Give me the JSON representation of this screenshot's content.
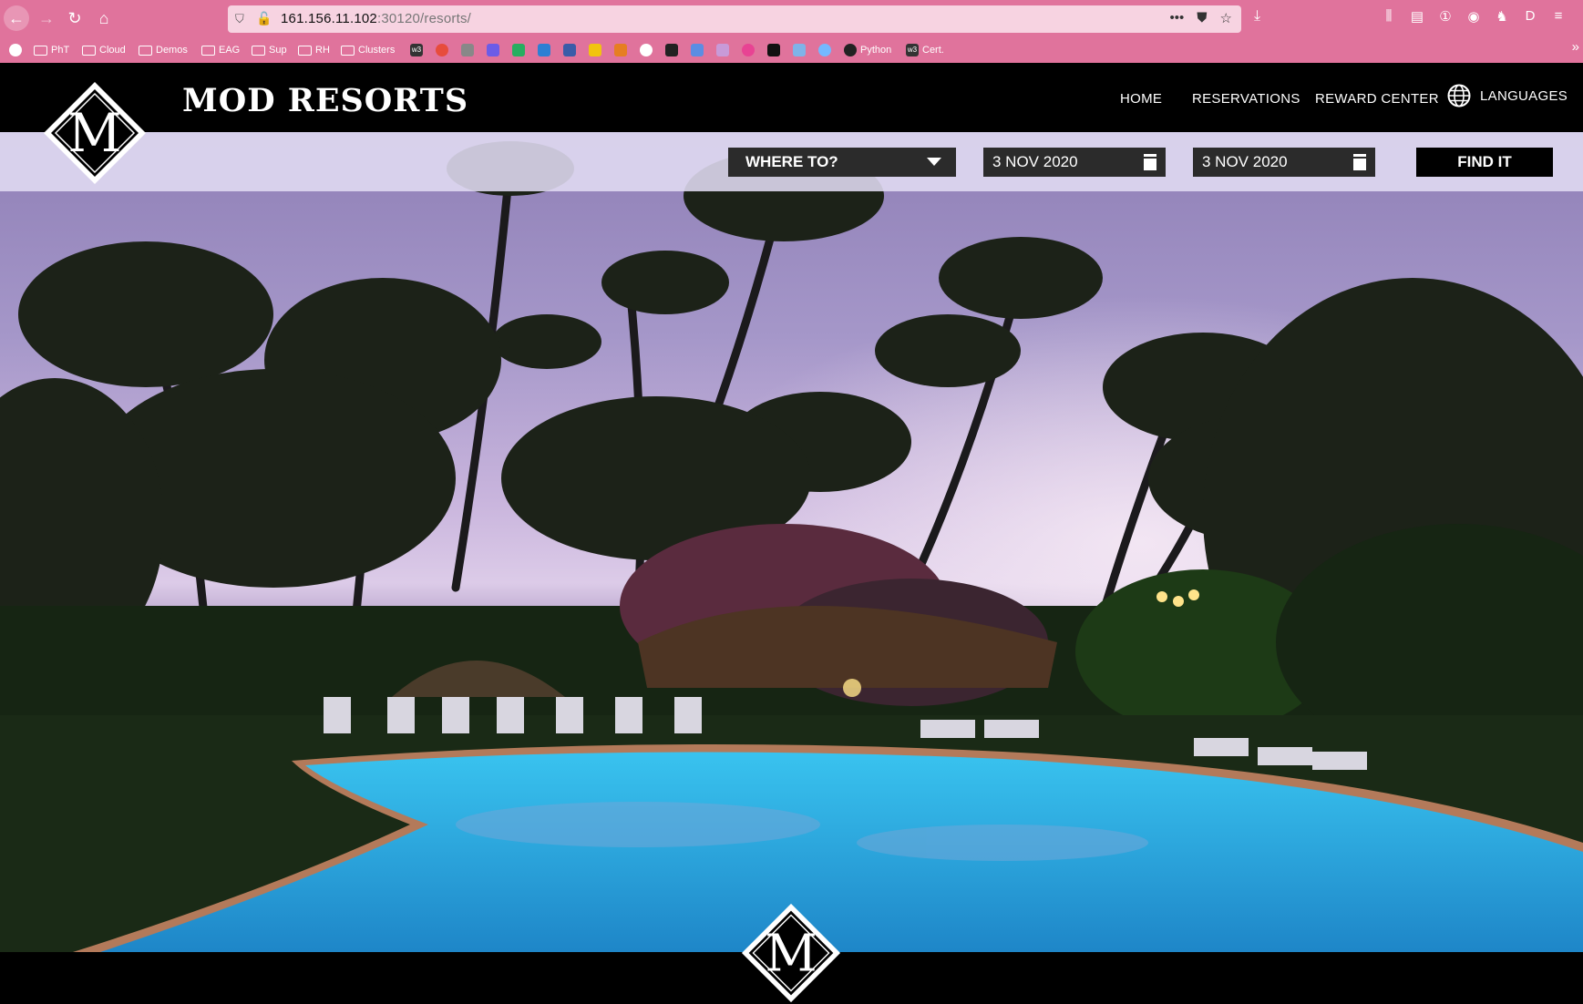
{
  "browser": {
    "url_host": "161.156.11.102",
    "url_rest": ":30120/resorts/",
    "bookmarks": [
      "PhT",
      "Cloud",
      "Demos",
      "EAG",
      "Sup",
      "RH",
      "Clusters",
      "Python",
      "Cert."
    ],
    "bookmark_w3_a": "w3",
    "bookmark_w3_b": "w3",
    "page_actions": "•••"
  },
  "site": {
    "brand": "MOD RESORTS",
    "logo_letter": "M",
    "nav": {
      "home": "HOME",
      "reservations": "RESERVATIONS",
      "reward_center": "REWARD CENTER",
      "languages": "LANGUAGES"
    },
    "search": {
      "where": "WHERE TO?",
      "checkin": "3 NOV 2020",
      "checkout": "3 NOV 2020",
      "submit": "FIND IT"
    }
  },
  "colors": {
    "chrome": "#e0739c",
    "header": "#000000",
    "searchbar": "#e1dcf2",
    "field": "#2b2b2b"
  }
}
